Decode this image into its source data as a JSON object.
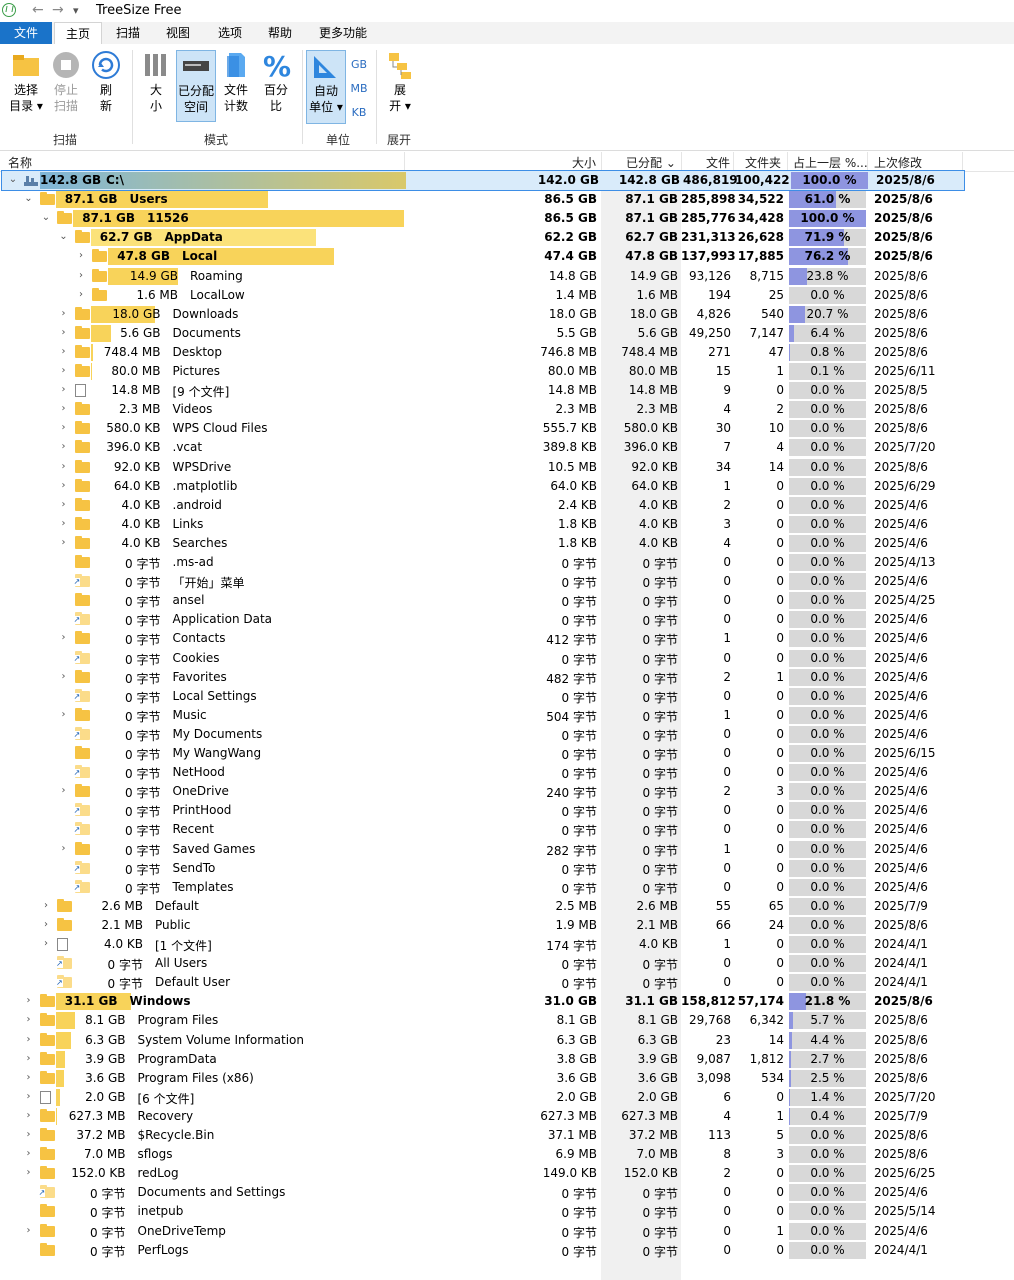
{
  "window": {
    "title": "TreeSize Free",
    "qa_back": "←",
    "qa_forward": "→",
    "qa_more": "▾"
  },
  "menu": {
    "tabs": [
      "文件",
      "主页",
      "扫描",
      "视图",
      "选项",
      "帮助",
      "更多功能"
    ]
  },
  "ribbon": {
    "buttons": [
      {
        "label1": "选择",
        "label2": "目录 ▾"
      },
      {
        "label1": "停止",
        "label2": "扫描"
      },
      {
        "label1": "刷",
        "label2": "新"
      },
      {
        "label1": "大",
        "label2": "小"
      },
      {
        "label1": "已分配",
        "label2": "空间"
      },
      {
        "label1": "文件",
        "label2": "计数"
      },
      {
        "label1": "百分",
        "label2": "比"
      },
      {
        "label1": "自动",
        "label2": "单位 ▾"
      },
      {
        "label1": "展",
        "label2": "开 ▾"
      }
    ],
    "units": [
      "GB",
      "MB",
      "KB"
    ],
    "groups": [
      "扫描",
      "模式",
      "单位",
      "展开"
    ]
  },
  "columns": {
    "name": "名称",
    "size": "大小",
    "allocated": "已分配 ⌄",
    "files": "文件",
    "folders": "文件夹",
    "percent": "占上一层 %...",
    "modified": "上次修改"
  },
  "colors": {
    "accent": "#1a73c9",
    "bar_yellow": "#f8d35a",
    "pct_fill": "#8e95e0"
  },
  "rows": [
    {
      "level": 0,
      "exp": "⌄",
      "icon": "drive",
      "bar": 1.0,
      "sizelbl": "142.8 GB",
      "name": "C:\\",
      "size": "142.0 GB",
      "alloc": "142.8 GB",
      "files": "486,819",
      "folders": "100,422",
      "pct": "100.0 %",
      "pctv": 1.0,
      "mod": "2025/8/6",
      "bold": true,
      "root": true
    },
    {
      "level": 1,
      "exp": "⌄",
      "icon": "folder",
      "bar": 0.611,
      "sizelbl": "87.1 GB",
      "name": "Users",
      "size": "86.5 GB",
      "alloc": "87.1 GB",
      "files": "285,898",
      "folders": "34,522",
      "pct": "61.0 %",
      "pctv": 0.61,
      "mod": "2025/8/6",
      "bold": true
    },
    {
      "level": 2,
      "exp": "⌄",
      "icon": "folder",
      "bar": 1.0,
      "sizelbl": "87.1 GB",
      "name": "11526",
      "size": "86.5 GB",
      "alloc": "87.1 GB",
      "files": "285,776",
      "folders": "34,428",
      "pct": "100.0 %",
      "pctv": 1.0,
      "mod": "2025/8/6",
      "bold": true
    },
    {
      "level": 3,
      "exp": "⌄",
      "icon": "folder-light",
      "bar": 0.719,
      "sizelbl": "62.7 GB",
      "name": "AppData",
      "size": "62.2 GB",
      "alloc": "62.7 GB",
      "files": "231,313",
      "folders": "26,628",
      "pct": "71.9 %",
      "pctv": 0.719,
      "mod": "2025/8/6",
      "bold": true
    },
    {
      "level": 4,
      "exp": "›",
      "icon": "folder",
      "bar": 0.762,
      "sizelbl": "47.8 GB",
      "name": "Local",
      "size": "47.4 GB",
      "alloc": "47.8 GB",
      "files": "137,993",
      "folders": "17,885",
      "pct": "76.2 %",
      "pctv": 0.762,
      "mod": "2025/8/6",
      "bold": true
    },
    {
      "level": 4,
      "exp": "›",
      "icon": "folder",
      "bar": 0.238,
      "sizelbl": "14.9 GB",
      "name": "Roaming",
      "size": "14.8 GB",
      "alloc": "14.9 GB",
      "files": "93,126",
      "folders": "8,715",
      "pct": "23.8 %",
      "pctv": 0.238,
      "mod": "2025/8/6"
    },
    {
      "level": 4,
      "exp": "›",
      "icon": "folder",
      "bar": 0.0,
      "sizelbl": "1.6 MB",
      "name": "LocalLow",
      "size": "1.4 MB",
      "alloc": "1.6 MB",
      "files": "194",
      "folders": "25",
      "pct": "0.0 %",
      "pctv": 0.0,
      "mod": "2025/8/6"
    },
    {
      "level": 3,
      "exp": "›",
      "icon": "folder",
      "bar": 0.207,
      "sizelbl": "18.0 GB",
      "name": "Downloads",
      "size": "18.0 GB",
      "alloc": "18.0 GB",
      "files": "4,826",
      "folders": "540",
      "pct": "20.7 %",
      "pctv": 0.207,
      "mod": "2025/8/6"
    },
    {
      "level": 3,
      "exp": "›",
      "icon": "folder",
      "bar": 0.064,
      "sizelbl": "5.6 GB",
      "name": "Documents",
      "size": "5.5 GB",
      "alloc": "5.6 GB",
      "files": "49,250",
      "folders": "7,147",
      "pct": "6.4 %",
      "pctv": 0.064,
      "mod": "2025/8/6"
    },
    {
      "level": 3,
      "exp": "›",
      "icon": "folder",
      "bar": 0.008,
      "sizelbl": "748.4 MB",
      "name": "Desktop",
      "size": "746.8 MB",
      "alloc": "748.4 MB",
      "files": "271",
      "folders": "47",
      "pct": "0.8 %",
      "pctv": 0.008,
      "mod": "2025/8/6"
    },
    {
      "level": 3,
      "exp": "›",
      "icon": "folder",
      "bar": 0.001,
      "sizelbl": "80.0 MB",
      "name": "Pictures",
      "size": "80.0 MB",
      "alloc": "80.0 MB",
      "files": "15",
      "folders": "1",
      "pct": "0.1 %",
      "pctv": 0.001,
      "mod": "2025/6/11"
    },
    {
      "level": 3,
      "exp": "›",
      "icon": "file",
      "bar": 0.0,
      "sizelbl": "14.8 MB",
      "name": "[9 个文件]",
      "size": "14.8 MB",
      "alloc": "14.8 MB",
      "files": "9",
      "folders": "0",
      "pct": "0.0 %",
      "pctv": 0.0,
      "mod": "2025/8/5"
    },
    {
      "level": 3,
      "exp": "›",
      "icon": "folder",
      "bar": 0.0,
      "sizelbl": "2.3 MB",
      "name": "Videos",
      "size": "2.3 MB",
      "alloc": "2.3 MB",
      "files": "4",
      "folders": "2",
      "pct": "0.0 %",
      "pctv": 0.0,
      "mod": "2025/8/6"
    },
    {
      "level": 3,
      "exp": "›",
      "icon": "folder",
      "bar": 0.0,
      "sizelbl": "580.0 KB",
      "name": "WPS Cloud Files",
      "size": "555.7 KB",
      "alloc": "580.0 KB",
      "files": "30",
      "folders": "10",
      "pct": "0.0 %",
      "pctv": 0.0,
      "mod": "2025/8/6"
    },
    {
      "level": 3,
      "exp": "›",
      "icon": "folder",
      "bar": 0.0,
      "sizelbl": "396.0 KB",
      "name": ".vcat",
      "size": "389.8 KB",
      "alloc": "396.0 KB",
      "files": "7",
      "folders": "4",
      "pct": "0.0 %",
      "pctv": 0.0,
      "mod": "2025/7/20"
    },
    {
      "level": 3,
      "exp": "›",
      "icon": "folder",
      "bar": 0.0,
      "sizelbl": "92.0 KB",
      "name": "WPSDrive",
      "size": "10.5 MB",
      "alloc": "92.0 KB",
      "files": "34",
      "folders": "14",
      "pct": "0.0 %",
      "pctv": 0.0,
      "mod": "2025/8/6"
    },
    {
      "level": 3,
      "exp": "›",
      "icon": "folder",
      "bar": 0.0,
      "sizelbl": "64.0 KB",
      "name": ".matplotlib",
      "size": "64.0 KB",
      "alloc": "64.0 KB",
      "files": "1",
      "folders": "0",
      "pct": "0.0 %",
      "pctv": 0.0,
      "mod": "2025/6/29"
    },
    {
      "level": 3,
      "exp": "›",
      "icon": "folder",
      "bar": 0.0,
      "sizelbl": "4.0 KB",
      "name": ".android",
      "size": "2.4 KB",
      "alloc": "4.0 KB",
      "files": "2",
      "folders": "0",
      "pct": "0.0 %",
      "pctv": 0.0,
      "mod": "2025/4/6"
    },
    {
      "level": 3,
      "exp": "›",
      "icon": "folder",
      "bar": 0.0,
      "sizelbl": "4.0 KB",
      "name": "Links",
      "size": "1.8 KB",
      "alloc": "4.0 KB",
      "files": "3",
      "folders": "0",
      "pct": "0.0 %",
      "pctv": 0.0,
      "mod": "2025/4/6"
    },
    {
      "level": 3,
      "exp": "›",
      "icon": "folder",
      "bar": 0.0,
      "sizelbl": "4.0 KB",
      "name": "Searches",
      "size": "1.8 KB",
      "alloc": "4.0 KB",
      "files": "4",
      "folders": "0",
      "pct": "0.0 %",
      "pctv": 0.0,
      "mod": "2025/4/6"
    },
    {
      "level": 3,
      "exp": "",
      "icon": "folder",
      "bar": 0.0,
      "sizelbl": "0 字节",
      "name": ".ms-ad",
      "size": "0 字节",
      "alloc": "0 字节",
      "files": "0",
      "folders": "0",
      "pct": "0.0 %",
      "pctv": 0.0,
      "mod": "2025/4/13"
    },
    {
      "level": 3,
      "exp": "",
      "icon": "link",
      "bar": 0.0,
      "sizelbl": "0 字节",
      "name": "「开始」菜单",
      "size": "0 字节",
      "alloc": "0 字节",
      "files": "0",
      "folders": "0",
      "pct": "0.0 %",
      "pctv": 0.0,
      "mod": "2025/4/6"
    },
    {
      "level": 3,
      "exp": "",
      "icon": "folder",
      "bar": 0.0,
      "sizelbl": "0 字节",
      "name": "ansel",
      "size": "0 字节",
      "alloc": "0 字节",
      "files": "0",
      "folders": "0",
      "pct": "0.0 %",
      "pctv": 0.0,
      "mod": "2025/4/25"
    },
    {
      "level": 3,
      "exp": "",
      "icon": "link",
      "bar": 0.0,
      "sizelbl": "0 字节",
      "name": "Application Data",
      "size": "0 字节",
      "alloc": "0 字节",
      "files": "0",
      "folders": "0",
      "pct": "0.0 %",
      "pctv": 0.0,
      "mod": "2025/4/6"
    },
    {
      "level": 3,
      "exp": "›",
      "icon": "folder",
      "bar": 0.0,
      "sizelbl": "0 字节",
      "name": "Contacts",
      "size": "412 字节",
      "alloc": "0 字节",
      "files": "1",
      "folders": "0",
      "pct": "0.0 %",
      "pctv": 0.0,
      "mod": "2025/4/6"
    },
    {
      "level": 3,
      "exp": "",
      "icon": "link",
      "bar": 0.0,
      "sizelbl": "0 字节",
      "name": "Cookies",
      "size": "0 字节",
      "alloc": "0 字节",
      "files": "0",
      "folders": "0",
      "pct": "0.0 %",
      "pctv": 0.0,
      "mod": "2025/4/6"
    },
    {
      "level": 3,
      "exp": "›",
      "icon": "folder",
      "bar": 0.0,
      "sizelbl": "0 字节",
      "name": "Favorites",
      "size": "482 字节",
      "alloc": "0 字节",
      "files": "2",
      "folders": "1",
      "pct": "0.0 %",
      "pctv": 0.0,
      "mod": "2025/4/6"
    },
    {
      "level": 3,
      "exp": "",
      "icon": "link",
      "bar": 0.0,
      "sizelbl": "0 字节",
      "name": "Local Settings",
      "size": "0 字节",
      "alloc": "0 字节",
      "files": "0",
      "folders": "0",
      "pct": "0.0 %",
      "pctv": 0.0,
      "mod": "2025/4/6"
    },
    {
      "level": 3,
      "exp": "›",
      "icon": "folder",
      "bar": 0.0,
      "sizelbl": "0 字节",
      "name": "Music",
      "size": "504 字节",
      "alloc": "0 字节",
      "files": "1",
      "folders": "0",
      "pct": "0.0 %",
      "pctv": 0.0,
      "mod": "2025/4/6"
    },
    {
      "level": 3,
      "exp": "",
      "icon": "link",
      "bar": 0.0,
      "sizelbl": "0 字节",
      "name": "My Documents",
      "size": "0 字节",
      "alloc": "0 字节",
      "files": "0",
      "folders": "0",
      "pct": "0.0 %",
      "pctv": 0.0,
      "mod": "2025/4/6"
    },
    {
      "level": 3,
      "exp": "",
      "icon": "folder",
      "bar": 0.0,
      "sizelbl": "0 字节",
      "name": "My WangWang",
      "size": "0 字节",
      "alloc": "0 字节",
      "files": "0",
      "folders": "0",
      "pct": "0.0 %",
      "pctv": 0.0,
      "mod": "2025/6/15"
    },
    {
      "level": 3,
      "exp": "",
      "icon": "link",
      "bar": 0.0,
      "sizelbl": "0 字节",
      "name": "NetHood",
      "size": "0 字节",
      "alloc": "0 字节",
      "files": "0",
      "folders": "0",
      "pct": "0.0 %",
      "pctv": 0.0,
      "mod": "2025/4/6"
    },
    {
      "level": 3,
      "exp": "›",
      "icon": "folder",
      "bar": 0.0,
      "sizelbl": "0 字节",
      "name": "OneDrive",
      "size": "240 字节",
      "alloc": "0 字节",
      "files": "2",
      "folders": "3",
      "pct": "0.0 %",
      "pctv": 0.0,
      "mod": "2025/4/6"
    },
    {
      "level": 3,
      "exp": "",
      "icon": "link",
      "bar": 0.0,
      "sizelbl": "0 字节",
      "name": "PrintHood",
      "size": "0 字节",
      "alloc": "0 字节",
      "files": "0",
      "folders": "0",
      "pct": "0.0 %",
      "pctv": 0.0,
      "mod": "2025/4/6"
    },
    {
      "level": 3,
      "exp": "",
      "icon": "link",
      "bar": 0.0,
      "sizelbl": "0 字节",
      "name": "Recent",
      "size": "0 字节",
      "alloc": "0 字节",
      "files": "0",
      "folders": "0",
      "pct": "0.0 %",
      "pctv": 0.0,
      "mod": "2025/4/6"
    },
    {
      "level": 3,
      "exp": "›",
      "icon": "folder",
      "bar": 0.0,
      "sizelbl": "0 字节",
      "name": "Saved Games",
      "size": "282 字节",
      "alloc": "0 字节",
      "files": "1",
      "folders": "0",
      "pct": "0.0 %",
      "pctv": 0.0,
      "mod": "2025/4/6"
    },
    {
      "level": 3,
      "exp": "",
      "icon": "link",
      "bar": 0.0,
      "sizelbl": "0 字节",
      "name": "SendTo",
      "size": "0 字节",
      "alloc": "0 字节",
      "files": "0",
      "folders": "0",
      "pct": "0.0 %",
      "pctv": 0.0,
      "mod": "2025/4/6"
    },
    {
      "level": 3,
      "exp": "",
      "icon": "link",
      "bar": 0.0,
      "sizelbl": "0 字节",
      "name": "Templates",
      "size": "0 字节",
      "alloc": "0 字节",
      "files": "0",
      "folders": "0",
      "pct": "0.0 %",
      "pctv": 0.0,
      "mod": "2025/4/6"
    },
    {
      "level": 2,
      "exp": "›",
      "icon": "folder",
      "bar": 0.0,
      "sizelbl": "2.6 MB",
      "name": "Default",
      "size": "2.5 MB",
      "alloc": "2.6 MB",
      "files": "55",
      "folders": "65",
      "pct": "0.0 %",
      "pctv": 0.0,
      "mod": "2025/7/9"
    },
    {
      "level": 2,
      "exp": "›",
      "icon": "folder",
      "bar": 0.0,
      "sizelbl": "2.1 MB",
      "name": "Public",
      "size": "1.9 MB",
      "alloc": "2.1 MB",
      "files": "66",
      "folders": "24",
      "pct": "0.0 %",
      "pctv": 0.0,
      "mod": "2025/8/6"
    },
    {
      "level": 2,
      "exp": "›",
      "icon": "file",
      "bar": 0.0,
      "sizelbl": "4.0 KB",
      "name": "[1 个文件]",
      "size": "174 字节",
      "alloc": "4.0 KB",
      "files": "1",
      "folders": "0",
      "pct": "0.0 %",
      "pctv": 0.0,
      "mod": "2024/4/1"
    },
    {
      "level": 2,
      "exp": "",
      "icon": "link",
      "bar": 0.0,
      "sizelbl": "0 字节",
      "name": "All Users",
      "size": "0 字节",
      "alloc": "0 字节",
      "files": "0",
      "folders": "0",
      "pct": "0.0 %",
      "pctv": 0.0,
      "mod": "2024/4/1"
    },
    {
      "level": 2,
      "exp": "",
      "icon": "link",
      "bar": 0.0,
      "sizelbl": "0 字节",
      "name": "Default User",
      "size": "0 字节",
      "alloc": "0 字节",
      "files": "0",
      "folders": "0",
      "pct": "0.0 %",
      "pctv": 0.0,
      "mod": "2024/4/1"
    },
    {
      "level": 1,
      "exp": "›",
      "icon": "folder",
      "bar": 0.218,
      "sizelbl": "31.1 GB",
      "name": "Windows",
      "size": "31.0 GB",
      "alloc": "31.1 GB",
      "files": "158,812",
      "folders": "57,174",
      "pct": "21.8 %",
      "pctv": 0.218,
      "mod": "2025/8/6",
      "bold": true
    },
    {
      "level": 1,
      "exp": "›",
      "icon": "folder",
      "bar": 0.057,
      "sizelbl": "8.1 GB",
      "name": "Program Files",
      "size": "8.1 GB",
      "alloc": "8.1 GB",
      "files": "29,768",
      "folders": "6,342",
      "pct": "5.7 %",
      "pctv": 0.057,
      "mod": "2025/8/6"
    },
    {
      "level": 1,
      "exp": "›",
      "icon": "folder",
      "bar": 0.044,
      "sizelbl": "6.3 GB",
      "name": "System Volume Information",
      "size": "6.3 GB",
      "alloc": "6.3 GB",
      "files": "23",
      "folders": "14",
      "pct": "4.4 %",
      "pctv": 0.044,
      "mod": "2025/8/6"
    },
    {
      "level": 1,
      "exp": "›",
      "icon": "folder",
      "bar": 0.027,
      "sizelbl": "3.9 GB",
      "name": "ProgramData",
      "size": "3.8 GB",
      "alloc": "3.9 GB",
      "files": "9,087",
      "folders": "1,812",
      "pct": "2.7 %",
      "pctv": 0.027,
      "mod": "2025/8/6"
    },
    {
      "level": 1,
      "exp": "›",
      "icon": "folder",
      "bar": 0.025,
      "sizelbl": "3.6 GB",
      "name": "Program Files (x86)",
      "size": "3.6 GB",
      "alloc": "3.6 GB",
      "files": "3,098",
      "folders": "534",
      "pct": "2.5 %",
      "pctv": 0.025,
      "mod": "2025/8/6"
    },
    {
      "level": 1,
      "exp": "›",
      "icon": "file",
      "bar": 0.014,
      "sizelbl": "2.0 GB",
      "name": "[6 个文件]",
      "size": "2.0 GB",
      "alloc": "2.0 GB",
      "files": "6",
      "folders": "0",
      "pct": "1.4 %",
      "pctv": 0.014,
      "mod": "2025/7/20"
    },
    {
      "level": 1,
      "exp": "›",
      "icon": "folder",
      "bar": 0.004,
      "sizelbl": "627.3 MB",
      "name": "Recovery",
      "size": "627.3 MB",
      "alloc": "627.3 MB",
      "files": "4",
      "folders": "1",
      "pct": "0.4 %",
      "pctv": 0.004,
      "mod": "2025/7/9"
    },
    {
      "level": 1,
      "exp": "›",
      "icon": "folder",
      "bar": 0.0,
      "sizelbl": "37.2 MB",
      "name": "$Recycle.Bin",
      "size": "37.1 MB",
      "alloc": "37.2 MB",
      "files": "113",
      "folders": "5",
      "pct": "0.0 %",
      "pctv": 0.0,
      "mod": "2025/8/6"
    },
    {
      "level": 1,
      "exp": "›",
      "icon": "folder",
      "bar": 0.0,
      "sizelbl": "7.0 MB",
      "name": "sflogs",
      "size": "6.9 MB",
      "alloc": "7.0 MB",
      "files": "8",
      "folders": "3",
      "pct": "0.0 %",
      "pctv": 0.0,
      "mod": "2025/8/6"
    },
    {
      "level": 1,
      "exp": "›",
      "icon": "folder",
      "bar": 0.0,
      "sizelbl": "152.0 KB",
      "name": "redLog",
      "size": "149.0 KB",
      "alloc": "152.0 KB",
      "files": "2",
      "folders": "0",
      "pct": "0.0 %",
      "pctv": 0.0,
      "mod": "2025/6/25"
    },
    {
      "level": 1,
      "exp": "",
      "icon": "link",
      "bar": 0.0,
      "sizelbl": "0 字节",
      "name": "Documents and Settings",
      "size": "0 字节",
      "alloc": "0 字节",
      "files": "0",
      "folders": "0",
      "pct": "0.0 %",
      "pctv": 0.0,
      "mod": "2025/4/6"
    },
    {
      "level": 1,
      "exp": "",
      "icon": "folder",
      "bar": 0.0,
      "sizelbl": "0 字节",
      "name": "inetpub",
      "size": "0 字节",
      "alloc": "0 字节",
      "files": "0",
      "folders": "0",
      "pct": "0.0 %",
      "pctv": 0.0,
      "mod": "2025/5/14"
    },
    {
      "level": 1,
      "exp": "›",
      "icon": "folder",
      "bar": 0.0,
      "sizelbl": "0 字节",
      "name": "OneDriveTemp",
      "size": "0 字节",
      "alloc": "0 字节",
      "files": "0",
      "folders": "1",
      "pct": "0.0 %",
      "pctv": 0.0,
      "mod": "2025/4/6"
    },
    {
      "level": 1,
      "exp": "",
      "icon": "folder",
      "bar": 0.0,
      "sizelbl": "0 字节",
      "name": "PerfLogs",
      "size": "0 字节",
      "alloc": "0 字节",
      "files": "0",
      "folders": "0",
      "pct": "0.0 %",
      "pctv": 0.0,
      "mod": "2024/4/1"
    }
  ]
}
